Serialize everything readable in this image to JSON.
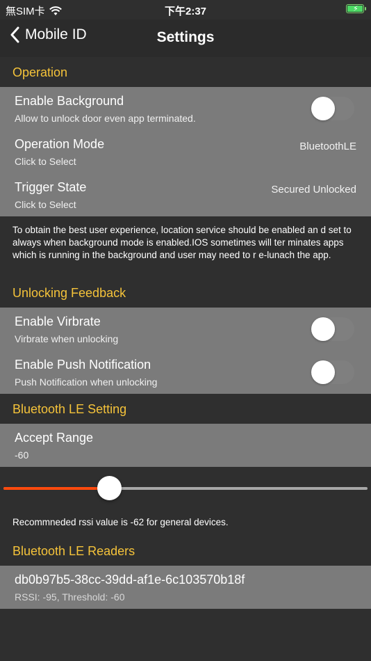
{
  "status_bar": {
    "carrier": "無SIM卡",
    "time": "下午2:37"
  },
  "nav": {
    "back_label": "Mobile ID",
    "title": "Settings"
  },
  "sections": {
    "operation": {
      "header": "Operation",
      "enable_background": {
        "title": "Enable Background",
        "subtitle": "Allow to unlock door even app terminated.",
        "on": false
      },
      "operation_mode": {
        "title": "Operation Mode",
        "subtitle": "Click to Select",
        "value": "BluetoothLE"
      },
      "trigger_state": {
        "title": "Trigger State",
        "subtitle": "Click to Select",
        "value": "Secured Unlocked"
      }
    },
    "operation_note": "To obtain the best user experience, location service should be enabled an d set to always when background mode is enabled.IOS sometimes will ter minates apps which is running in the background and user may need to r e-lunach the app.",
    "feedback": {
      "header": "Unlocking Feedback",
      "vibrate": {
        "title": "Enable Virbrate",
        "subtitle": "Virbrate when unlocking",
        "on": false
      },
      "push": {
        "title": "Enable Push Notification",
        "subtitle": "Push Notification when unlocking",
        "on": false
      }
    },
    "ble_setting": {
      "header": "Bluetooth LE Setting",
      "accept_range": {
        "title": "Accept Range",
        "value": "-60"
      },
      "slider_fraction": 0.29,
      "note": "Recommneded rssi value is -62 for general devices."
    },
    "ble_readers": {
      "header": "Bluetooth LE Readers",
      "readers": [
        {
          "id": "db0b97b5-38cc-39dd-af1e-6c103570b18f",
          "detail": "RSSI: -95, Threshold: -60"
        }
      ]
    }
  },
  "colors": {
    "accent": "#f5c33a",
    "slider_active": "#ff4a0d",
    "group_bg": "#7b7b7b",
    "page_bg": "#2f2f2f"
  }
}
